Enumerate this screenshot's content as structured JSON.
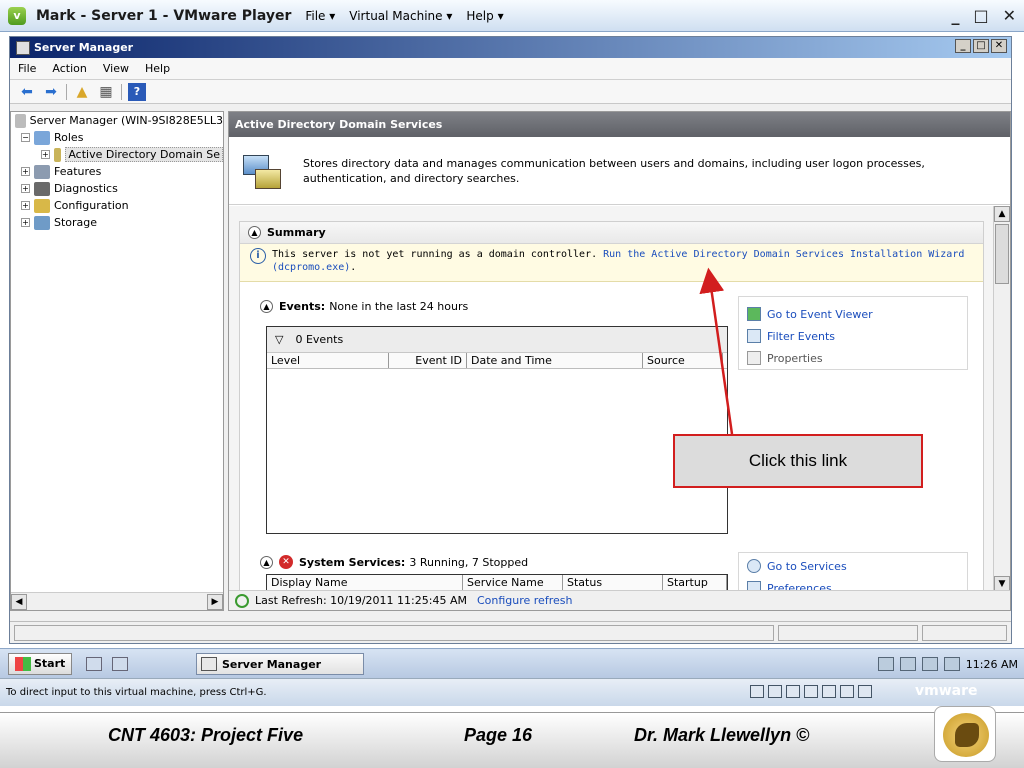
{
  "vm": {
    "title": "Mark - Server 1 - VMware Player",
    "menu": [
      "File ▾",
      "Virtual Machine ▾",
      "Help ▾"
    ],
    "status_text": "To direct input to this virtual machine, press Ctrl+G.",
    "logo": "vmware"
  },
  "sm": {
    "title": "Server Manager",
    "menu": [
      "File",
      "Action",
      "View",
      "Help"
    ],
    "tree": [
      {
        "label": "Server Manager (WIN-9SI828E5LL3",
        "indent": 0,
        "box": ""
      },
      {
        "label": "Roles",
        "indent": 1,
        "box": "−"
      },
      {
        "label": "Active Directory Domain Se",
        "indent": 2,
        "box": "+",
        "selected": true
      },
      {
        "label": "Features",
        "indent": 1,
        "box": "+"
      },
      {
        "label": "Diagnostics",
        "indent": 1,
        "box": "+"
      },
      {
        "label": "Configuration",
        "indent": 1,
        "box": "+"
      },
      {
        "label": "Storage",
        "indent": 1,
        "box": "+"
      }
    ],
    "pane_title": "Active Directory Domain Services",
    "description": "Stores directory data and manages communication between users and domains, including user logon processes, authentication, and directory searches.",
    "summary_label": "Summary",
    "info_text": "This server is not yet running as a domain controller.",
    "info_link": "Run the Active Directory Domain Services Installation Wizard",
    "info_link2": "(dcpromo.exe)",
    "info_tail": ".",
    "events": {
      "label": "Events:",
      "summary": "None in the last 24 hours",
      "filter_count": "0 Events",
      "columns": [
        "Level",
        "Event ID",
        "Date and Time",
        "Source"
      ]
    },
    "event_actions": [
      {
        "label": "Go to Event Viewer",
        "enabled": true
      },
      {
        "label": "Filter Events",
        "enabled": true
      },
      {
        "label": "Properties",
        "enabled": false
      }
    ],
    "services": {
      "label": "System Services:",
      "summary": "3 Running, 7 Stopped",
      "columns": [
        "Display Name",
        "Service Name",
        "Status",
        "Startup"
      ]
    },
    "service_actions": [
      "Go to Services",
      "Preferences"
    ],
    "last_refresh": "Last Refresh: 10/19/2011 11:25:45 AM",
    "configure_refresh": "Configure refresh"
  },
  "callout": "Click this link",
  "taskbar": {
    "start": "Start",
    "task": "Server Manager",
    "clock": "11:26 AM"
  },
  "footer": {
    "left": "CNT 4603: Project Five",
    "center": "Page 16",
    "right": "Dr. Mark Llewellyn ©"
  },
  "colors": {
    "link": "#1a4dbc",
    "callout_border": "#d21e1e",
    "pane_header": "#6e7076"
  }
}
